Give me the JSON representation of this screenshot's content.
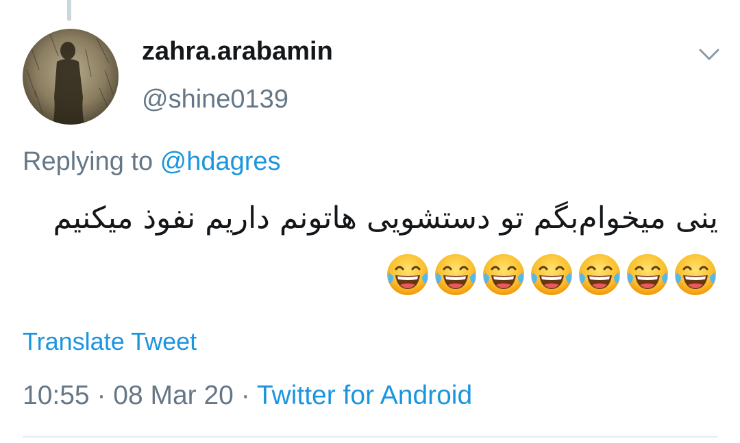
{
  "tweet": {
    "display_name": "zahra.arabamin",
    "handle": "@shine0139",
    "replying_prefix": "Replying to ",
    "replying_to": "@hdagres",
    "text": "ینی میخوام‌بگم تو دستشویی هاتونم داریم نفوذ میکنیم",
    "emoji_name": "face-with-tears-of-joy-icon",
    "emoji_count": 7,
    "translate_label": "Translate Tweet",
    "time": "10:55",
    "separator": " · ",
    "date": "08 Mar 20",
    "source": "Twitter for Android"
  },
  "colors": {
    "text": "#14171a",
    "secondary": "#657786",
    "link": "#1b95e0",
    "divider": "#e6ecf0"
  }
}
